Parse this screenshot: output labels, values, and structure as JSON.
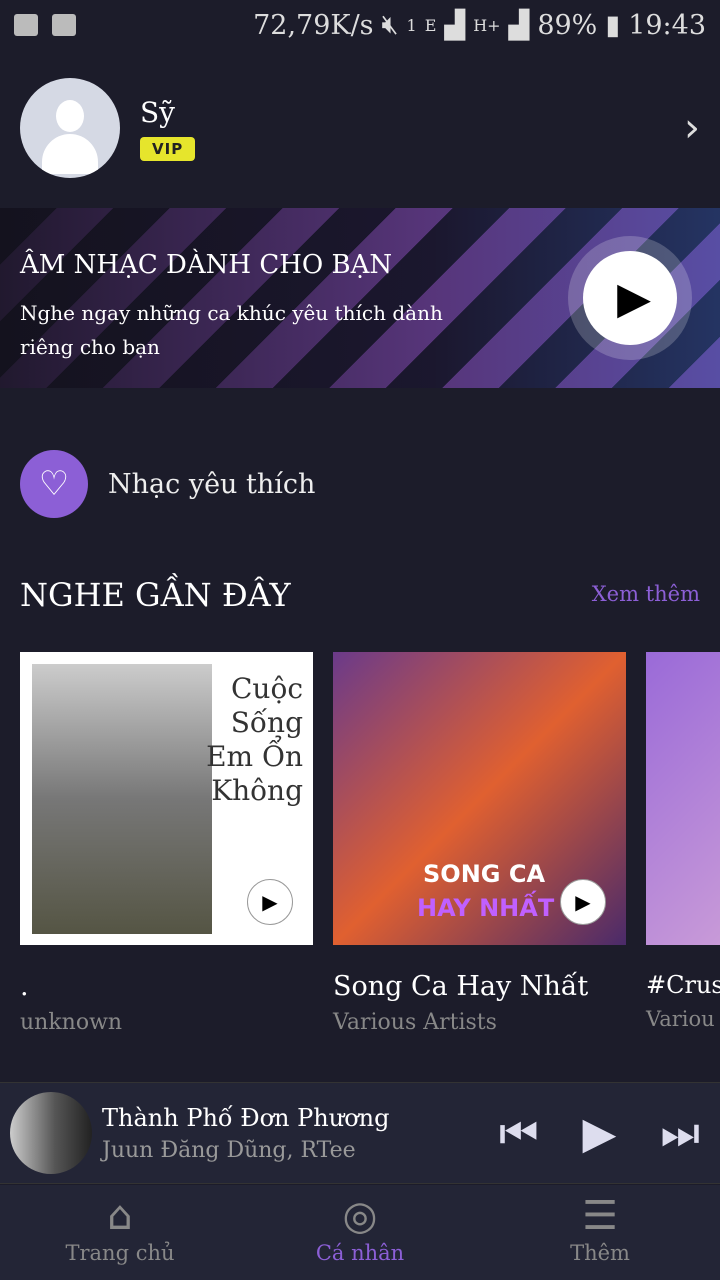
{
  "status": {
    "speed": "72,79K/s",
    "sim": "1",
    "net1": "E",
    "net2": "H+",
    "battery": "89%",
    "time": "19:43"
  },
  "profile": {
    "name": "Sỹ",
    "badge": "VIP"
  },
  "banner": {
    "title": "ÂM NHẠC DÀNH CHO BẠN",
    "subtitle": "Nghe ngay những ca khúc yêu thích dành riêng cho bạn"
  },
  "favorites": {
    "label": "Nhạc yêu thích"
  },
  "recent": {
    "title": "NGHE GẦN ĐÂY",
    "more": "Xem thêm",
    "items": [
      {
        "title": ".",
        "artist": "unknown",
        "art_text": "Cuộc Sống Em Ổn Không"
      },
      {
        "title": "Song Ca Hay Nhất",
        "artist": "Various Artists",
        "art_text1": "SONG CA",
        "art_text2": "HAY NHẤT"
      },
      {
        "title": "#Crus",
        "artist": "Variou"
      }
    ]
  },
  "player": {
    "title": "Thành Phố Đơn Phương",
    "artist": "Juun Đăng Dũng, RTee"
  },
  "nav": [
    {
      "label": "Trang chủ"
    },
    {
      "label": "Cá nhân",
      "active": true
    },
    {
      "label": "Thêm"
    }
  ],
  "colors": {
    "accent": "#8c5fd6",
    "background": "#1c1c2a",
    "vip": "#e6e52c"
  }
}
